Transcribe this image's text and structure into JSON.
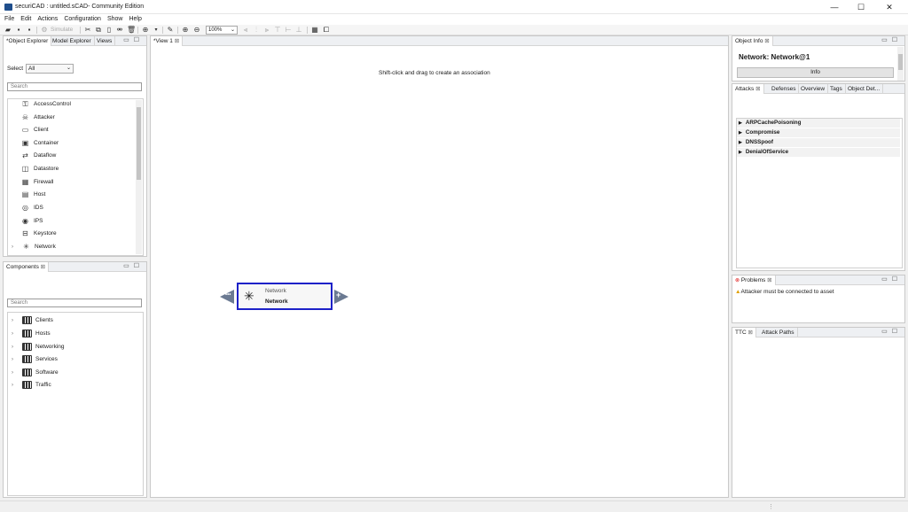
{
  "window": {
    "title": "securiCAD : untitled.sCAD- Community Edition",
    "minimize_glyph": "—",
    "maximize_glyph": "☐",
    "close_glyph": "✕"
  },
  "menu": [
    "File",
    "Edit",
    "Actions",
    "Configuration",
    "Show",
    "Help"
  ],
  "toolbar": {
    "simulate_label": "Simulate",
    "zoom": "100%"
  },
  "object_explorer": {
    "tabs": [
      "*Object Explorer",
      "Model Explorer",
      "Views"
    ],
    "select_label": "Select",
    "select_value": "All",
    "search_placeholder": "Search",
    "items": [
      {
        "label": "AccessControl",
        "icon": "⚿"
      },
      {
        "label": "Attacker",
        "icon": "☠"
      },
      {
        "label": "Client",
        "icon": "▭"
      },
      {
        "label": "Container",
        "icon": "▣"
      },
      {
        "label": "Dataflow",
        "icon": "⇄"
      },
      {
        "label": "Datastore",
        "icon": "◫"
      },
      {
        "label": "Firewall",
        "icon": "▦"
      },
      {
        "label": "Host",
        "icon": "▤"
      },
      {
        "label": "IDS",
        "icon": "◎"
      },
      {
        "label": "IPS",
        "icon": "◉"
      },
      {
        "label": "Keystore",
        "icon": "⊟"
      },
      {
        "label": "Network",
        "icon": "✳"
      }
    ]
  },
  "components": {
    "tab": "Components",
    "search_placeholder": "Search",
    "items": [
      "Clients",
      "Hosts",
      "Networking",
      "Services",
      "Software",
      "Traffic"
    ]
  },
  "view": {
    "tab": "*View 1",
    "hint": "Shift-click and drag to create an association",
    "node": {
      "type_label": "Network",
      "name": "Network",
      "left_handle": "•••",
      "right_handle": "+"
    }
  },
  "object_info": {
    "tab": "Object Info",
    "heading": "Network: Network@1",
    "info_button": "Info"
  },
  "attacks_panel": {
    "tabs": [
      "Attacks",
      "Defenses",
      "Overview",
      "Tags",
      "Object Det..."
    ],
    "attacks": [
      "ARPCachePoisoning",
      "Compromise",
      "DNSSpoof",
      "DenialOfService"
    ]
  },
  "problems": {
    "tab": "Problems",
    "items": [
      "Attacker must be connected to asset"
    ]
  },
  "ttc": {
    "tabs": [
      "TTC",
      "Attack Paths"
    ]
  },
  "colors": {
    "selection_border": "#1d21c8",
    "node_handle": "#6b7a92"
  }
}
